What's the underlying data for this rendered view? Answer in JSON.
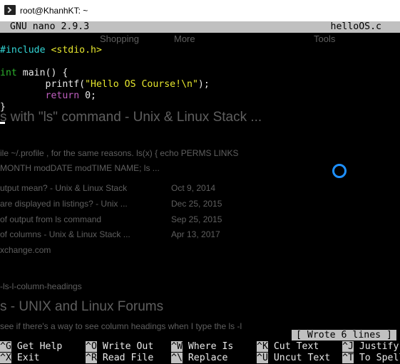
{
  "window": {
    "title": "root@KhanhKT: ~",
    "icon": "terminal-icon"
  },
  "nano": {
    "version": "GNU nano 2.9.3",
    "filename": "helloOS.c"
  },
  "code": {
    "l1_include": "#include",
    "l1_header": "<stdio.h>",
    "l3_type": "int",
    "l3_rest": " main() {",
    "l4_indent": "        printf(",
    "l4_string": "\"Hello OS Course!\\n\"",
    "l4_end": ");",
    "l5_indent": "        ",
    "l5_kw": "return",
    "l5_rest": " 0;",
    "l6": "}"
  },
  "status_message": "[ Wrote 6 lines ]",
  "shortcuts": [
    {
      "key": "^G",
      "label": "Get Help"
    },
    {
      "key": "^O",
      "label": "Write Out"
    },
    {
      "key": "^W",
      "label": "Where Is"
    },
    {
      "key": "^K",
      "label": "Cut Text"
    },
    {
      "key": "^J",
      "label": "Justify"
    },
    {
      "key": "^X",
      "label": "Exit"
    },
    {
      "key": "^R",
      "label": "Read File"
    },
    {
      "key": "^\\",
      "label": "Replace"
    },
    {
      "key": "^U",
      "label": "Uncut Text"
    },
    {
      "key": "^T",
      "label": "To Spell"
    }
  ],
  "background_ghost": {
    "g1": "Shopping",
    "g2": "More",
    "g3": "Tools",
    "g4": "s with \"ls\" command - Unix & Linux Stack ...",
    "g5": "ile ~/.profile , for the same reasons. ls(x) { echo PERMS LINKS",
    "g6": "MONTH modDATE modTIME NAME; ls ...",
    "g7": "utput mean? - Unix & Linux Stack",
    "g8": "Oct 9, 2014",
    "g9": "are displayed in listings? - Unix ...",
    "g10": "Dec 25, 2015",
    "g11": "of output from ls command",
    "g12": "Sep 25, 2015",
    "g13": "of columns - Unix & Linux Stack ...",
    "g14": "Apr 13, 2017",
    "g15": "xchange.com",
    "g16": "-ls-l-column-headings",
    "g17": "s - UNIX and Linux Forums",
    "g18": "see if there's a way to see column headings when I type the ls -l"
  }
}
